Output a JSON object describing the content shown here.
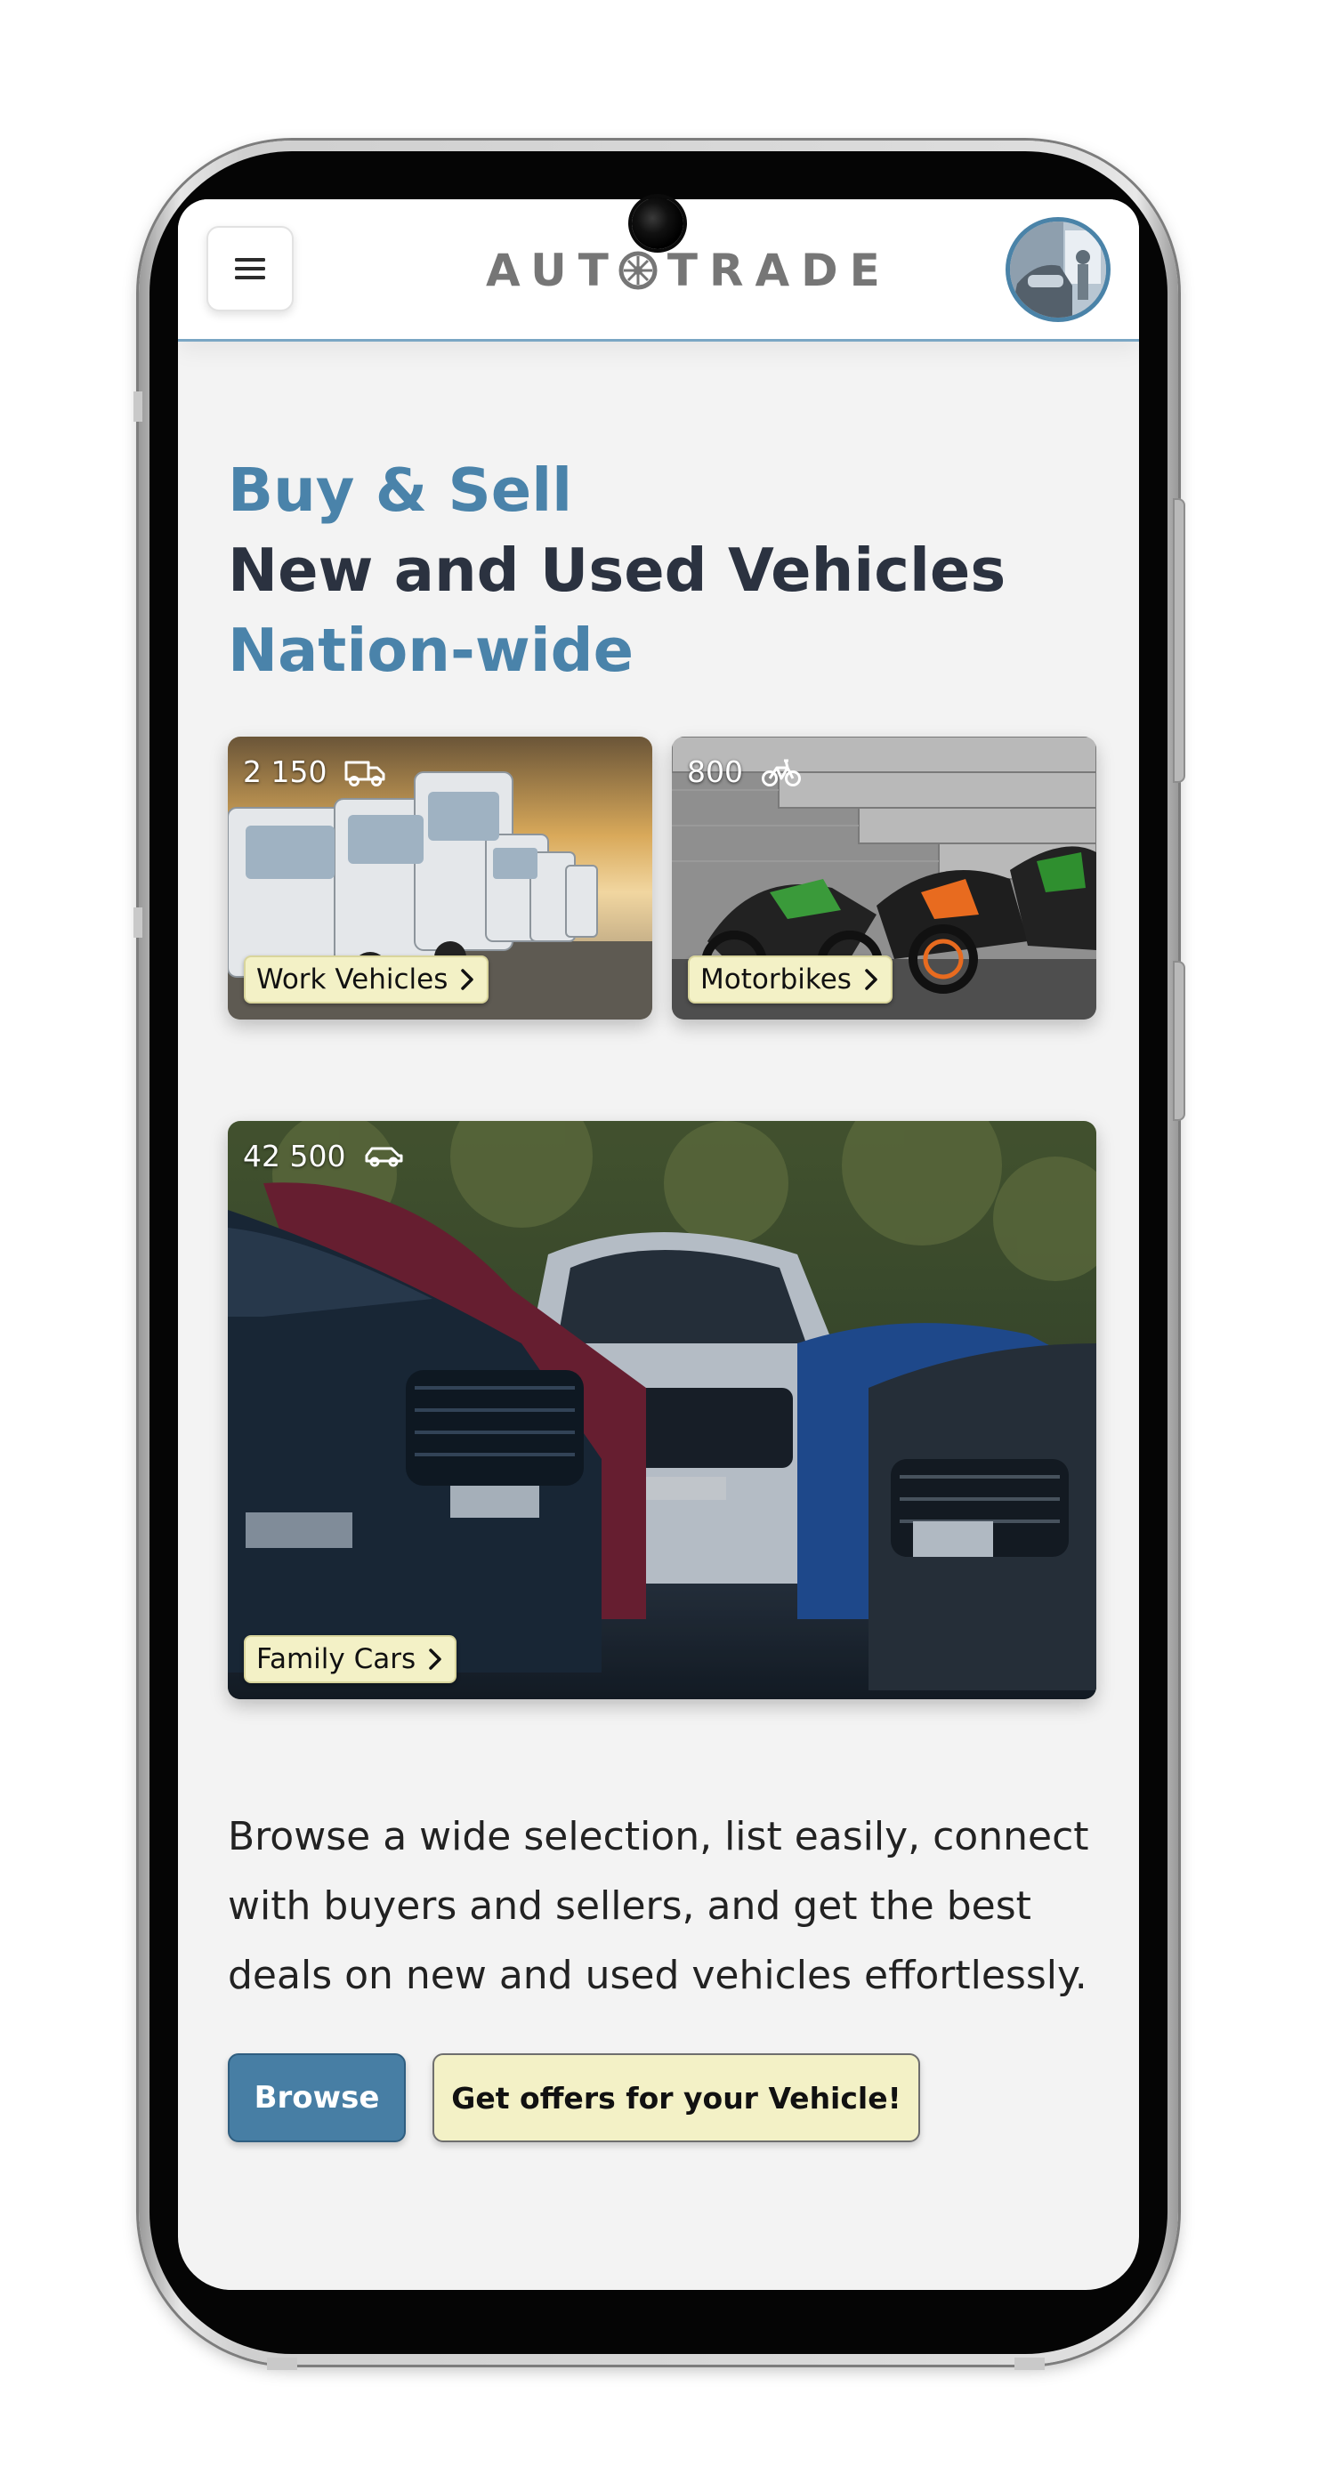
{
  "header": {
    "logo_left": "AUT",
    "logo_right": "TRADE",
    "menu_icon": "hamburger-icon",
    "avatar_icon": "user-avatar"
  },
  "hero": {
    "line1": "Buy & Sell",
    "line2": "New and Used Vehicles",
    "line3": "Nation-wide"
  },
  "categories": [
    {
      "count": "2 150",
      "label": "Work Vehicles",
      "icon": "truck-icon"
    },
    {
      "count": "800",
      "label": "Motorbikes",
      "icon": "bicycle-icon"
    },
    {
      "count": "42 500",
      "label": "Family Cars",
      "icon": "car-icon"
    }
  ],
  "description": "Browse a wide selection, list easily, connect with buyers and sellers, and get the best deals on new and used vehicles effortlessly.",
  "buttons": {
    "browse": "Browse",
    "offers": "Get offers for your Vehicle!"
  },
  "colors": {
    "accent": "#4a83aa",
    "dark_text": "#2b3240",
    "label_bg": "#f3f1c6",
    "background": "#f3f3f3"
  }
}
